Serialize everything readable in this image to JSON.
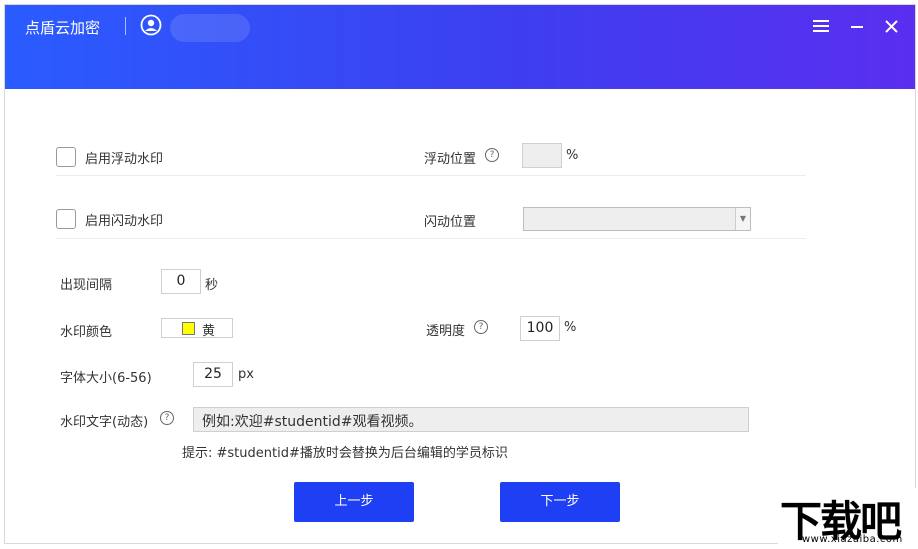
{
  "app": {
    "title": "点盾云加密"
  },
  "window_controls": {
    "menu_icon": "hamburger-menu-icon",
    "minimize_icon": "minimize-icon",
    "close_icon": "close-icon"
  },
  "form": {
    "float_watermark": {
      "label": "启用浮动水印",
      "checked": false
    },
    "float_position": {
      "label": "浮动位置",
      "value": "",
      "unit": "%"
    },
    "flash_watermark": {
      "label": "启用闪动水印",
      "checked": false
    },
    "flash_position": {
      "label": "闪动位置",
      "value": ""
    },
    "interval": {
      "label": "出现间隔",
      "value": "0",
      "unit": "秒"
    },
    "color": {
      "label": "水印颜色",
      "value": "黄",
      "swatch": "#ffff00"
    },
    "opacity": {
      "label": "透明度",
      "value": "100",
      "unit": "%"
    },
    "font_size": {
      "label": "字体大小(6-56)",
      "value": "25",
      "unit": "px"
    },
    "text": {
      "label": "水印文字(动态)",
      "placeholder": "例如:欢迎#studentid#观看视频。"
    },
    "hint": "提示: #studentid#播放时会替换为后台编辑的学员标识"
  },
  "buttons": {
    "prev": "上一步",
    "next": "下一步"
  },
  "watermark_logo": {
    "mark": "下载吧",
    "url": "www.xiazaiba.com"
  },
  "colors": {
    "accent": "#1f3ff5",
    "header_start": "#2a5cff",
    "header_end": "#5a2ef0"
  }
}
